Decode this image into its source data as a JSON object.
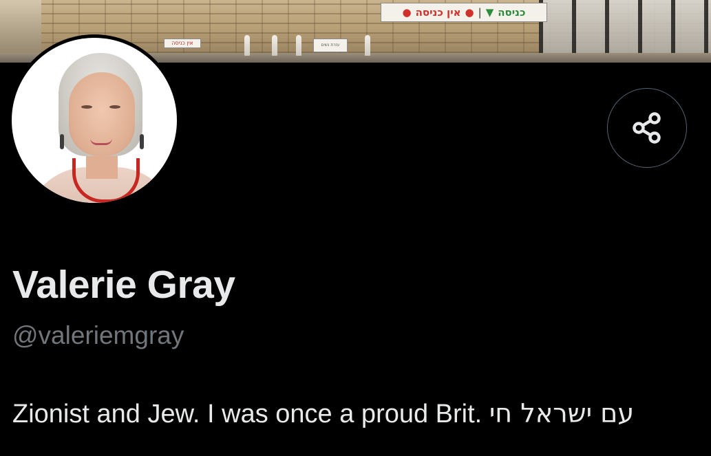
{
  "banner": {
    "sign_main": {
      "no_entry_left": "אין כניסה",
      "separator": "|",
      "entry": "כניסה",
      "no_entry_marker": "●",
      "entry_marker": "▼"
    },
    "sign_small": "אין כניסה",
    "sign_tiny": "עזרת נשים"
  },
  "profile": {
    "display_name": "Valerie Gray",
    "handle": "@valeriemgray",
    "bio_text": "Zionist and Jew. I was once a proud Brit.",
    "bio_hebrew": "עם ישראל חי"
  },
  "colors": {
    "background": "#000000",
    "name": "#e7e9ea",
    "handle": "#71767b",
    "button_border": "#536471"
  },
  "icons": {
    "share": "share-icon"
  }
}
